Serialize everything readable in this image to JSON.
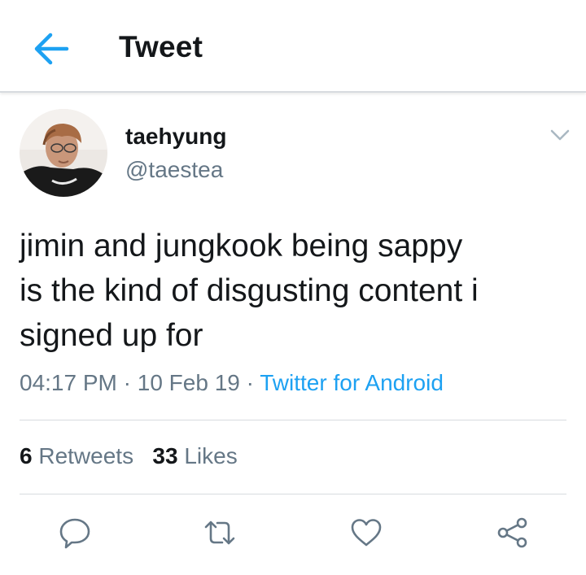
{
  "header": {
    "title": "Tweet",
    "back_icon": "arrow-left-icon",
    "accent_color": "#1da1f2"
  },
  "tweet": {
    "display_name": "taehyung",
    "handle": "@taestea",
    "text_lines": [
      "jimin and jungkook being sappy",
      "is the kind of disgusting content i",
      "signed up for"
    ],
    "time": "04:17 PM",
    "separator": " · ",
    "date": "10 Feb 19",
    "source": "Twitter for Android"
  },
  "stats": {
    "retweets_count": "6",
    "retweets_label": "Retweets",
    "likes_count": "33",
    "likes_label": "Likes"
  },
  "actions": [
    "reply-icon",
    "retweet-icon",
    "like-icon",
    "share-icon"
  ],
  "colors": {
    "text": "#14171a",
    "secondary": "#657786",
    "link": "#1da1f2",
    "divider": "#d7dbdf"
  }
}
